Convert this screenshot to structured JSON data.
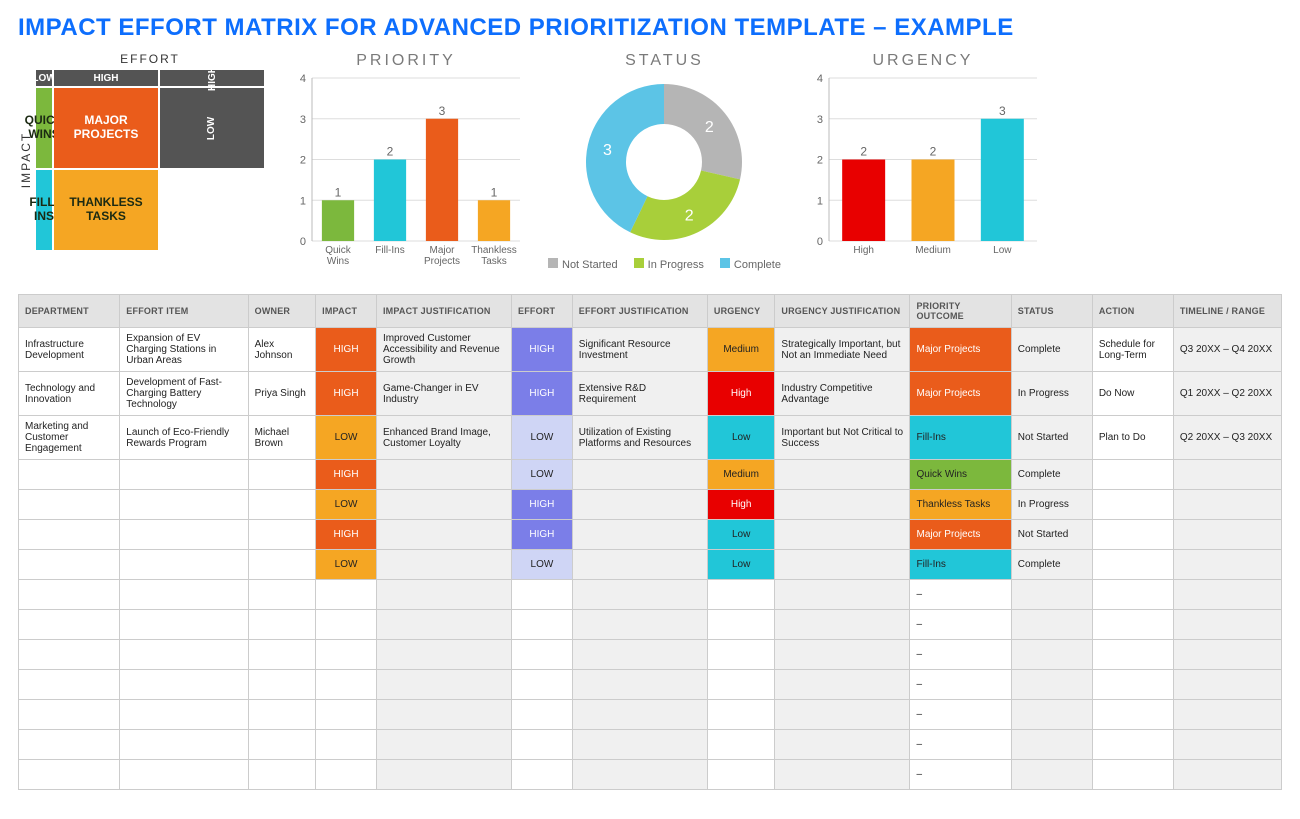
{
  "title": "IMPACT EFFORT MATRIX FOR ADVANCED PRIORITIZATION TEMPLATE – EXAMPLE",
  "matrix": {
    "axis_effort": "EFFORT",
    "axis_impact": "IMPACT",
    "hdr_low": "LOW",
    "hdr_high": "HIGH",
    "qw": "QUICK WINS",
    "mp": "MAJOR PROJECTS",
    "fi": "FILL-INS",
    "tt": "THANKLESS TASKS"
  },
  "chart_data": [
    {
      "type": "bar",
      "title": "PRIORITY",
      "ylim": [
        0,
        4
      ],
      "categories": [
        "Quick Wins",
        "Fill-Ins",
        "Major Projects",
        "Thankless Tasks"
      ],
      "values": [
        1,
        2,
        3,
        1
      ],
      "colors": [
        "#7cb83d",
        "#21c6d8",
        "#ea5c1b",
        "#f5a623"
      ]
    },
    {
      "type": "pie",
      "title": "STATUS",
      "series": [
        {
          "name": "Not Started",
          "value": 2,
          "color": "#b5b5b5"
        },
        {
          "name": "In Progress",
          "value": 2,
          "color": "#a8cf3a"
        },
        {
          "name": "Complete",
          "value": 3,
          "color": "#5cc4e6"
        }
      ]
    },
    {
      "type": "bar",
      "title": "URGENCY",
      "ylim": [
        0,
        4
      ],
      "categories": [
        "High",
        "Medium",
        "Low"
      ],
      "values": [
        2,
        2,
        3
      ],
      "colors": [
        "#e80000",
        "#f5a623",
        "#21c6d8"
      ]
    }
  ],
  "table": {
    "headers": [
      "DEPARTMENT",
      "EFFORT ITEM",
      "OWNER",
      "IMPACT",
      "IMPACT JUSTIFICATION",
      "EFFORT",
      "EFFORT JUSTIFICATION",
      "URGENCY",
      "URGENCY JUSTIFICATION",
      "PRIORITY OUTCOME",
      "STATUS",
      "ACTION",
      "TIMELINE / RANGE"
    ],
    "col_widths": [
      "7.5%",
      "9.5%",
      "5%",
      "4.5%",
      "10%",
      "4.5%",
      "10%",
      "5%",
      "10%",
      "7.5%",
      "6%",
      "6%",
      "8%"
    ],
    "rows": [
      {
        "department": "Infrastructure Development",
        "effort_item": "Expansion of EV Charging Stations in Urban Areas",
        "owner": "Alex Johnson",
        "impact": "HIGH",
        "impact_just": "Improved Customer Accessibility and Revenue Growth",
        "effort": "HIGH",
        "effort_just": "Significant Resource Investment",
        "urgency": "Medium",
        "urgency_just": "Strategically Important, but Not an Immediate Need",
        "priority": "Major Projects",
        "status": "Complete",
        "action": "Schedule for Long-Term",
        "timeline": "Q3 20XX – Q4 20XX"
      },
      {
        "department": "Technology and Innovation",
        "effort_item": "Development of Fast-Charging Battery Technology",
        "owner": "Priya Singh",
        "impact": "HIGH",
        "impact_just": "Game-Changer in EV Industry",
        "effort": "HIGH",
        "effort_just": "Extensive R&D Requirement",
        "urgency": "High",
        "urgency_just": "Industry Competitive Advantage",
        "priority": "Major Projects",
        "status": "In Progress",
        "action": "Do Now",
        "timeline": "Q1 20XX – Q2 20XX"
      },
      {
        "department": "Marketing and Customer Engagement",
        "effort_item": "Launch of Eco-Friendly Rewards Program",
        "owner": "Michael Brown",
        "impact": "LOW",
        "impact_just": "Enhanced Brand Image, Customer Loyalty",
        "effort": "LOW",
        "effort_just": "Utilization of Existing Platforms and Resources",
        "urgency": "Low",
        "urgency_just": "Important but Not Critical to Success",
        "priority": "Fill-Ins",
        "status": "Not Started",
        "action": "Plan to Do",
        "timeline": "Q2 20XX – Q3 20XX"
      },
      {
        "impact": "HIGH",
        "effort": "LOW",
        "urgency": "Medium",
        "priority": "Quick Wins",
        "status": "Complete"
      },
      {
        "impact": "LOW",
        "effort": "HIGH",
        "urgency": "High",
        "priority": "Thankless Tasks",
        "status": "In Progress"
      },
      {
        "impact": "HIGH",
        "effort": "HIGH",
        "urgency": "Low",
        "priority": "Major Projects",
        "status": "Not Started"
      },
      {
        "impact": "LOW",
        "effort": "LOW",
        "urgency": "Low",
        "priority": "Fill-Ins",
        "status": "Complete"
      },
      {
        "priority": "–"
      },
      {
        "priority": "–"
      },
      {
        "priority": "–"
      },
      {
        "priority": "–"
      },
      {
        "priority": "–"
      },
      {
        "priority": "–"
      },
      {
        "priority": "–"
      }
    ]
  }
}
